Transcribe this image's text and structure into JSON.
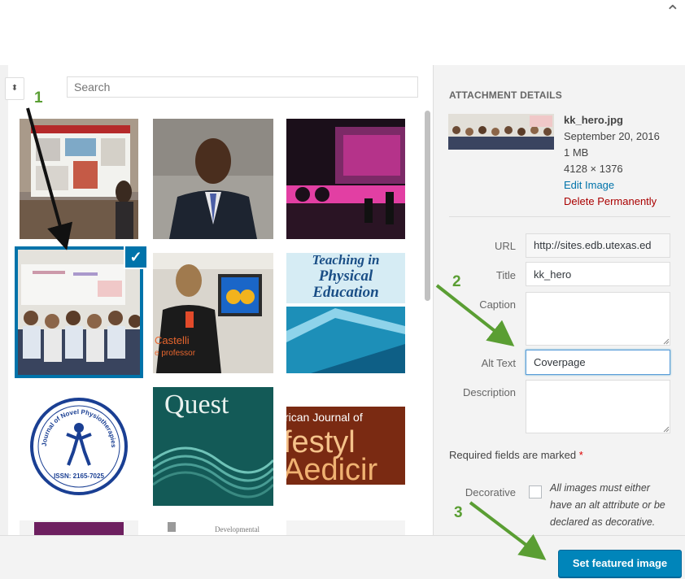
{
  "modal": {
    "close_icon": "close-icon"
  },
  "toolbar": {
    "filter_glyph": "⬍",
    "search_placeholder": "Search"
  },
  "grid": {
    "tiles": [
      {
        "subject": "poster-presentation"
      },
      {
        "subject": "portrait-man-in-suit"
      },
      {
        "subject": "conference-stage"
      },
      {
        "subject": "classroom-children",
        "selected": true
      },
      {
        "subject": "woman-at-lab-screen",
        "overlay_text": [
          "Castelli",
          "e professor"
        ]
      },
      {
        "subject": "journal-cover-physical-education",
        "overlay_text": [
          "Teaching in",
          "Physical",
          "Education"
        ]
      },
      {
        "subject": "journal-seal-physiotherapies",
        "overlay_text": [
          "Journal of Novel Physiotherapies",
          "ISSN: 2165-7025"
        ]
      },
      {
        "subject": "journal-cover-quest",
        "overlay_text": [
          "Quest"
        ]
      },
      {
        "subject": "journal-cover-lifestyle-medicine",
        "overlay_text": [
          "rican Journal of",
          "festyl",
          "Aedicir"
        ]
      },
      {
        "subject": "journal-cover-purple"
      },
      {
        "subject": "journal-cover-developmental",
        "overlay_text": [
          "Developmental"
        ]
      },
      {
        "subject": "blank-cover"
      }
    ]
  },
  "details": {
    "heading": "ATTACHMENT DETAILS",
    "filename": "kk_hero.jpg",
    "date": "September 20, 2016",
    "size": "1 MB",
    "dimensions": "4128 × 1376",
    "edit_link": "Edit Image",
    "delete_link": "Delete Permanently",
    "fields": {
      "url_label": "URL",
      "url_value": "http://sites.edb.utexas.ed",
      "title_label": "Title",
      "title_value": "kk_hero",
      "caption_label": "Caption",
      "caption_value": "",
      "alt_label": "Alt Text",
      "alt_value": "Coverpage",
      "description_label": "Description",
      "description_value": ""
    },
    "required_note": "Required fields are marked",
    "required_star": "*",
    "decorative_label": "Decorative",
    "decorative_note": "All images must either have an alt attribute or be declared as decorative."
  },
  "footer": {
    "primary_label": "Set featured image"
  },
  "annotations": [
    {
      "number": "1"
    },
    {
      "number": "2"
    },
    {
      "number": "3"
    }
  ],
  "colors": {
    "accent": "#0073aa",
    "primary_button": "#0085ba",
    "annotation": "#5a9e33",
    "danger": "#a00000"
  }
}
